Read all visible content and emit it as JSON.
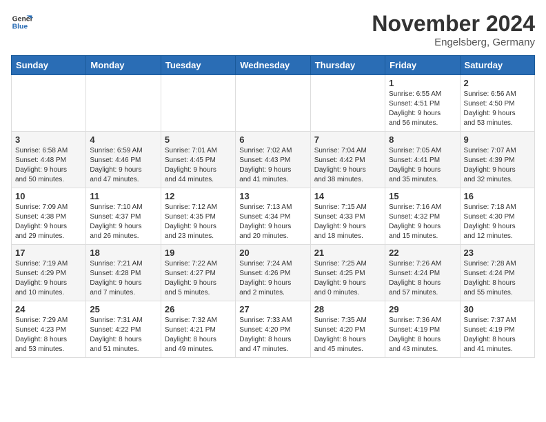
{
  "header": {
    "logo_line1": "General",
    "logo_line2": "Blue",
    "month": "November 2024",
    "location": "Engelsberg, Germany"
  },
  "days_of_week": [
    "Sunday",
    "Monday",
    "Tuesday",
    "Wednesday",
    "Thursday",
    "Friday",
    "Saturday"
  ],
  "weeks": [
    [
      {
        "day": "",
        "info": ""
      },
      {
        "day": "",
        "info": ""
      },
      {
        "day": "",
        "info": ""
      },
      {
        "day": "",
        "info": ""
      },
      {
        "day": "",
        "info": ""
      },
      {
        "day": "1",
        "info": "Sunrise: 6:55 AM\nSunset: 4:51 PM\nDaylight: 9 hours\nand 56 minutes."
      },
      {
        "day": "2",
        "info": "Sunrise: 6:56 AM\nSunset: 4:50 PM\nDaylight: 9 hours\nand 53 minutes."
      }
    ],
    [
      {
        "day": "3",
        "info": "Sunrise: 6:58 AM\nSunset: 4:48 PM\nDaylight: 9 hours\nand 50 minutes."
      },
      {
        "day": "4",
        "info": "Sunrise: 6:59 AM\nSunset: 4:46 PM\nDaylight: 9 hours\nand 47 minutes."
      },
      {
        "day": "5",
        "info": "Sunrise: 7:01 AM\nSunset: 4:45 PM\nDaylight: 9 hours\nand 44 minutes."
      },
      {
        "day": "6",
        "info": "Sunrise: 7:02 AM\nSunset: 4:43 PM\nDaylight: 9 hours\nand 41 minutes."
      },
      {
        "day": "7",
        "info": "Sunrise: 7:04 AM\nSunset: 4:42 PM\nDaylight: 9 hours\nand 38 minutes."
      },
      {
        "day": "8",
        "info": "Sunrise: 7:05 AM\nSunset: 4:41 PM\nDaylight: 9 hours\nand 35 minutes."
      },
      {
        "day": "9",
        "info": "Sunrise: 7:07 AM\nSunset: 4:39 PM\nDaylight: 9 hours\nand 32 minutes."
      }
    ],
    [
      {
        "day": "10",
        "info": "Sunrise: 7:09 AM\nSunset: 4:38 PM\nDaylight: 9 hours\nand 29 minutes."
      },
      {
        "day": "11",
        "info": "Sunrise: 7:10 AM\nSunset: 4:37 PM\nDaylight: 9 hours\nand 26 minutes."
      },
      {
        "day": "12",
        "info": "Sunrise: 7:12 AM\nSunset: 4:35 PM\nDaylight: 9 hours\nand 23 minutes."
      },
      {
        "day": "13",
        "info": "Sunrise: 7:13 AM\nSunset: 4:34 PM\nDaylight: 9 hours\nand 20 minutes."
      },
      {
        "day": "14",
        "info": "Sunrise: 7:15 AM\nSunset: 4:33 PM\nDaylight: 9 hours\nand 18 minutes."
      },
      {
        "day": "15",
        "info": "Sunrise: 7:16 AM\nSunset: 4:32 PM\nDaylight: 9 hours\nand 15 minutes."
      },
      {
        "day": "16",
        "info": "Sunrise: 7:18 AM\nSunset: 4:30 PM\nDaylight: 9 hours\nand 12 minutes."
      }
    ],
    [
      {
        "day": "17",
        "info": "Sunrise: 7:19 AM\nSunset: 4:29 PM\nDaylight: 9 hours\nand 10 minutes."
      },
      {
        "day": "18",
        "info": "Sunrise: 7:21 AM\nSunset: 4:28 PM\nDaylight: 9 hours\nand 7 minutes."
      },
      {
        "day": "19",
        "info": "Sunrise: 7:22 AM\nSunset: 4:27 PM\nDaylight: 9 hours\nand 5 minutes."
      },
      {
        "day": "20",
        "info": "Sunrise: 7:24 AM\nSunset: 4:26 PM\nDaylight: 9 hours\nand 2 minutes."
      },
      {
        "day": "21",
        "info": "Sunrise: 7:25 AM\nSunset: 4:25 PM\nDaylight: 9 hours\nand 0 minutes."
      },
      {
        "day": "22",
        "info": "Sunrise: 7:26 AM\nSunset: 4:24 PM\nDaylight: 8 hours\nand 57 minutes."
      },
      {
        "day": "23",
        "info": "Sunrise: 7:28 AM\nSunset: 4:24 PM\nDaylight: 8 hours\nand 55 minutes."
      }
    ],
    [
      {
        "day": "24",
        "info": "Sunrise: 7:29 AM\nSunset: 4:23 PM\nDaylight: 8 hours\nand 53 minutes."
      },
      {
        "day": "25",
        "info": "Sunrise: 7:31 AM\nSunset: 4:22 PM\nDaylight: 8 hours\nand 51 minutes."
      },
      {
        "day": "26",
        "info": "Sunrise: 7:32 AM\nSunset: 4:21 PM\nDaylight: 8 hours\nand 49 minutes."
      },
      {
        "day": "27",
        "info": "Sunrise: 7:33 AM\nSunset: 4:20 PM\nDaylight: 8 hours\nand 47 minutes."
      },
      {
        "day": "28",
        "info": "Sunrise: 7:35 AM\nSunset: 4:20 PM\nDaylight: 8 hours\nand 45 minutes."
      },
      {
        "day": "29",
        "info": "Sunrise: 7:36 AM\nSunset: 4:19 PM\nDaylight: 8 hours\nand 43 minutes."
      },
      {
        "day": "30",
        "info": "Sunrise: 7:37 AM\nSunset: 4:19 PM\nDaylight: 8 hours\nand 41 minutes."
      }
    ]
  ]
}
